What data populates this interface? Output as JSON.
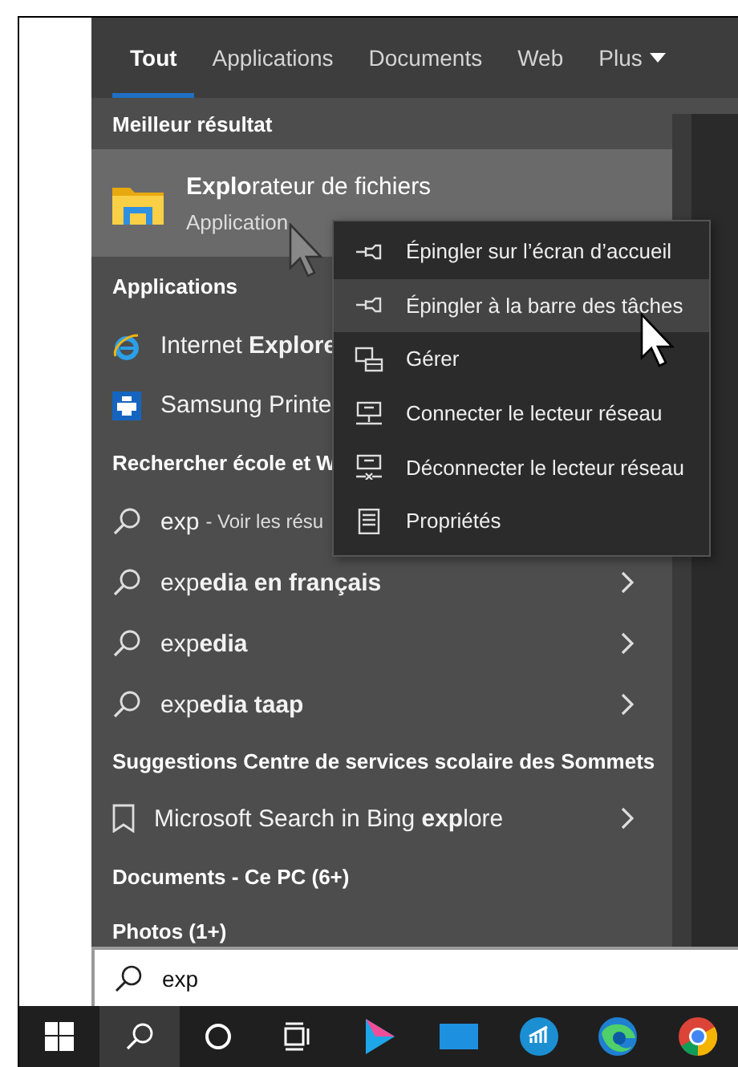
{
  "tabs": [
    {
      "label": "Tout",
      "selected": true,
      "kind": "tab"
    },
    {
      "label": "Applications",
      "selected": false,
      "kind": "tab"
    },
    {
      "label": "Documents",
      "selected": false,
      "kind": "tab"
    },
    {
      "label": "Web",
      "selected": false,
      "kind": "tab"
    },
    {
      "label": "Plus",
      "selected": false,
      "kind": "menu"
    }
  ],
  "best_result": {
    "heading": "Meilleur résultat",
    "title": "**Explo**rateur de fichiers",
    "subtitle": "Application",
    "selected": true
  },
  "sections": [
    {
      "heading": "Applications",
      "items": [
        {
          "kind": "ie",
          "text": "Internet **Explore**"
        },
        {
          "kind": "printer",
          "text": "Samsung Printe"
        }
      ]
    },
    {
      "heading": "Rechercher école et W",
      "items": [
        {
          "kind": "search",
          "text": "exp",
          "hint": "- Voir les résu"
        },
        {
          "kind": "search",
          "text": "exp**edia en français**",
          "chevron": true
        },
        {
          "kind": "search",
          "text": "exp**edia**",
          "chevron": true
        },
        {
          "kind": "search",
          "text": "exp**edia taap**",
          "chevron": true
        }
      ]
    },
    {
      "heading": "Suggestions Centre de services scolaire des Sommets",
      "items": [
        {
          "kind": "bookmark",
          "text": "Microsoft Search in Bing **exp**lore",
          "chevron": true
        }
      ]
    },
    {
      "heading": "Documents - Ce PC (6+)"
    },
    {
      "heading": "Photos (1+)"
    }
  ],
  "context_menu": [
    {
      "kind": "pin",
      "label": "Épingler sur l’écran d’accueil",
      "selected": false
    },
    {
      "kind": "pin",
      "label": "Épingler à la barre des tâches",
      "selected": true
    },
    {
      "kind": "manage",
      "label": "Gérer",
      "selected": false
    },
    {
      "kind": "connect",
      "label": "Connecter le lecteur réseau",
      "selected": false
    },
    {
      "kind": "disconnect",
      "label": "Déconnecter le lecteur réseau",
      "selected": false
    },
    {
      "kind": "properties",
      "label": "Propriétés",
      "selected": false
    }
  ],
  "search": {
    "value": "exp"
  },
  "taskbar": [
    {
      "kind": "start",
      "selected": false
    },
    {
      "kind": "search",
      "selected": true
    },
    {
      "kind": "cortana",
      "selected": false
    },
    {
      "kind": "taskview",
      "selected": false
    },
    {
      "kind": "play",
      "selected": false
    },
    {
      "kind": "screen",
      "selected": false
    },
    {
      "kind": "chart",
      "selected": false
    },
    {
      "kind": "edge",
      "selected": false
    },
    {
      "kind": "chrome",
      "selected": false
    }
  ]
}
